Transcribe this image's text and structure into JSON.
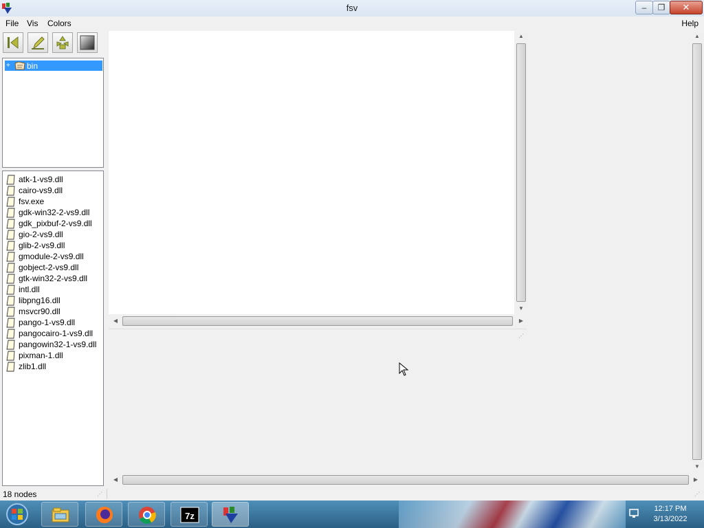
{
  "window": {
    "title": "fsv"
  },
  "window_controls": {
    "minimize": "–",
    "maximize": "❐",
    "close": "✕"
  },
  "menu": {
    "file": "File",
    "vis": "Vis",
    "colors": "Colors",
    "help": "Help"
  },
  "toolbar": {
    "buttons": [
      {
        "icon": "back-to-start-icon"
      },
      {
        "icon": "pencil-icon"
      },
      {
        "icon": "birdseye-icon"
      },
      {
        "icon": "color-gradient-icon"
      }
    ]
  },
  "tree": {
    "expander": "+",
    "selected_label": "bin",
    "selected_icon": "folder-hand-icon"
  },
  "files": [
    "atk-1-vs9.dll",
    "cairo-vs9.dll",
    "fsv.exe",
    "gdk-win32-2-vs9.dll",
    "gdk_pixbuf-2-vs9.dll",
    "gio-2-vs9.dll",
    "glib-2-vs9.dll",
    "gmodule-2-vs9.dll",
    "gobject-2-vs9.dll",
    "gtk-win32-2-vs9.dll",
    "intl.dll",
    "libpng16.dll",
    "msvcr90.dll",
    "pango-1-vs9.dll",
    "pangocairo-1-vs9.dll",
    "pangowin32-1-vs9.dll",
    "pixman-1.dll",
    "zlib1.dll"
  ],
  "status": {
    "text": "18 nodes",
    "grip": "⋰"
  },
  "scroll_arrows": {
    "up": "▲",
    "down": "▼",
    "left": "◀",
    "right": "▶"
  },
  "taskbar": {
    "time": "12:17 PM",
    "date": "3/13/2022",
    "apps": [
      "file-explorer-icon",
      "firefox-icon",
      "chrome-icon",
      "7zip-icon",
      "fsv-icon"
    ],
    "label_7z": "7z"
  },
  "colors": {
    "selection": "#3399ff",
    "taskbar": "#2b5f85"
  }
}
